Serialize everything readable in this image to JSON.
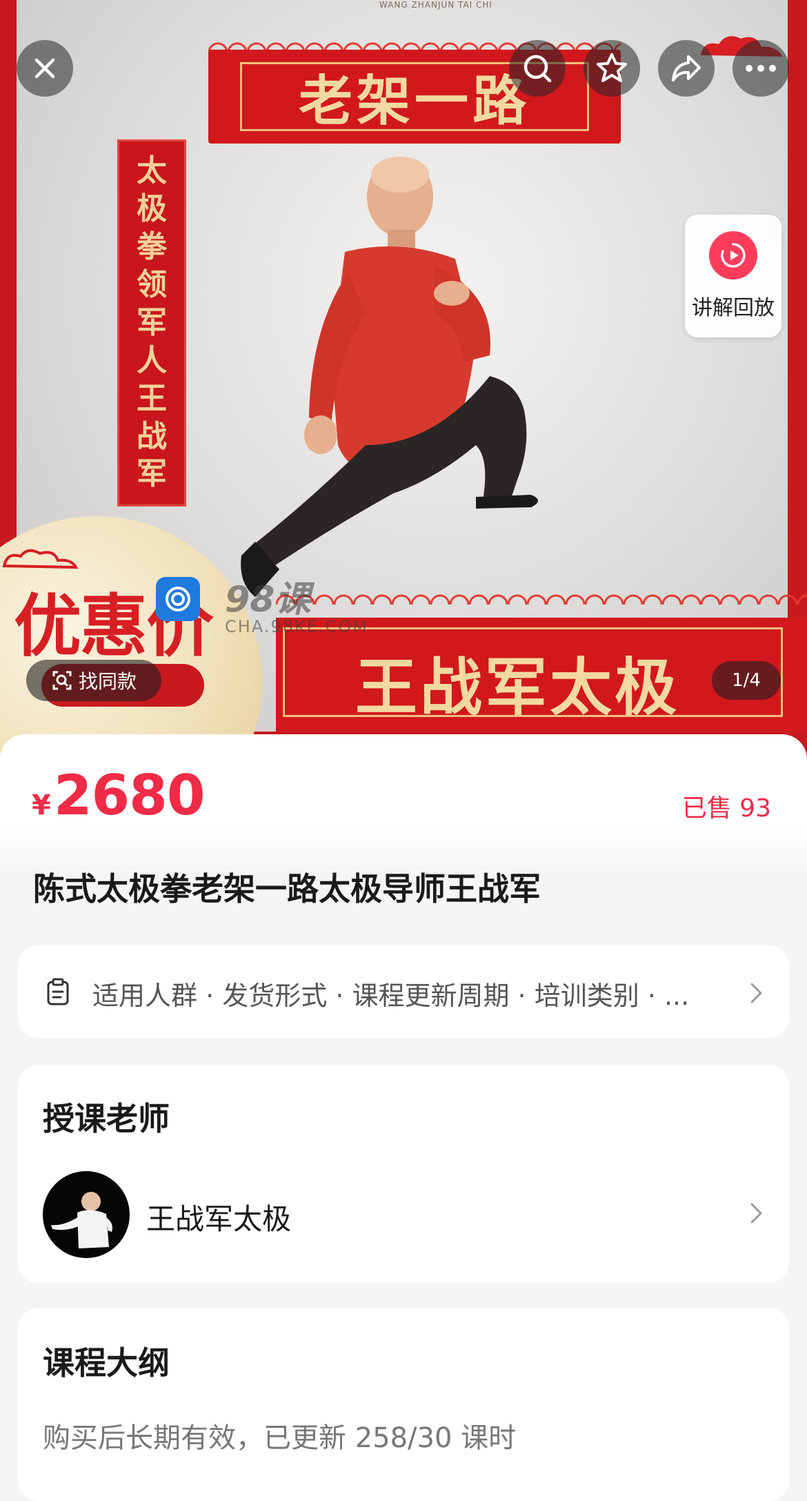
{
  "hero": {
    "brand_caption": "WANG ZHANJUN TAI CHI",
    "banner_top": "老架一路",
    "vertical_banner": [
      "太",
      "极",
      "拳",
      "领",
      "军",
      "人",
      "王",
      "战",
      "军"
    ],
    "promo_label": "优惠价",
    "banner_bottom": "王战军太极",
    "watermark": {
      "text": "98课",
      "domain": "CHA.98KE.COM"
    },
    "controls": {
      "close_icon": "close-icon",
      "search_icon": "search-icon",
      "favorite_icon": "star-icon",
      "share_icon": "share-icon",
      "more_icon": "more-icon"
    },
    "replay_label": "讲解回放",
    "find_similar_label": "找同款",
    "pager": "1/4"
  },
  "product": {
    "currency": "¥",
    "price": "2680",
    "sold": "已售 93",
    "title": "陈式太极拳老架一路太极导师王战军"
  },
  "attributes": {
    "text": "适用人群 · 发货形式 · 课程更新周期 · 培训类别 · ..."
  },
  "teacher": {
    "section_title": "授课老师",
    "name": "王战军太极"
  },
  "outline": {
    "section_title": "课程大纲",
    "description": "购买后长期有效，已更新 258/30 课时"
  },
  "colors": {
    "accent": "#ef2b46",
    "hero_red": "#c8191e",
    "gold": "#f2d9a0"
  }
}
